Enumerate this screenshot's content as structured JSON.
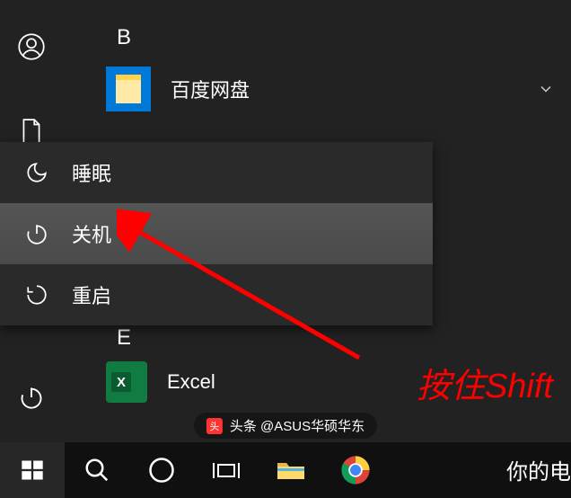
{
  "sections": {
    "b_header": "B",
    "e_header": "E"
  },
  "apps": {
    "baidu": "百度网盘",
    "excel": "Excel"
  },
  "power_menu": {
    "sleep": "睡眠",
    "shutdown": "关机",
    "restart": "重启"
  },
  "annotation": "按住Shift",
  "watermark": "头条 @ASUS华硕华东",
  "truncated": "你的电"
}
